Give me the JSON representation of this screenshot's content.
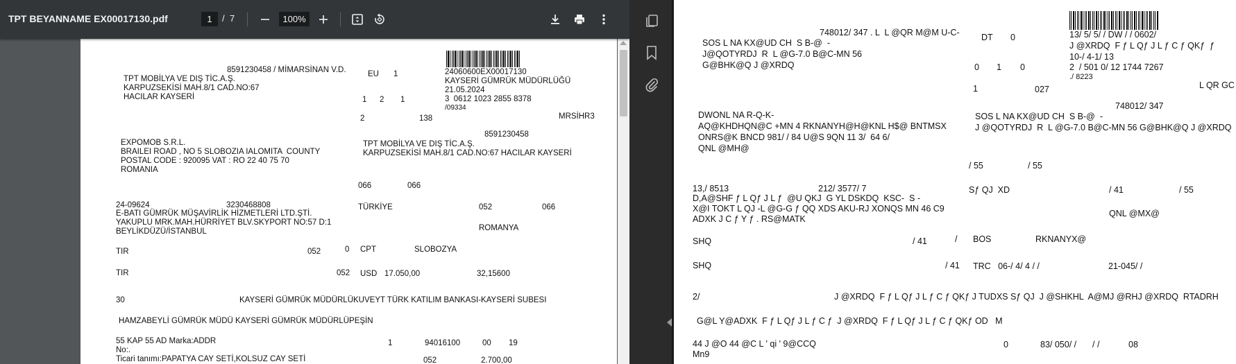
{
  "toolbar": {
    "title": "TPT BEYANNAME EX00017130.pdf",
    "page_current": "1",
    "page_sep": "/",
    "page_total": "7",
    "zoom": "100%",
    "icons": [
      "minus-icon",
      "plus-icon",
      "fit-page-icon",
      "rotate-icon",
      "download-icon",
      "print-icon",
      "more-vert-icon"
    ]
  },
  "sidebar": {
    "icons": [
      "copy-pages-icon",
      "bookmark-icon",
      "attachment-icon",
      "collapse-arrow-icon"
    ]
  },
  "doc": {
    "l1": "8591230458 / MİMARSİNAN V.D.",
    "l2": "TPT MOBİLYA VE DIŞ TİC.A.Ş.",
    "l3": "KARPUZSEKİSİ MAH.8/1 CAD.NO:67",
    "l4": "HACILAR KAYSERİ",
    "eu": "EU",
    "eu1": "1",
    "barnum": "24060600EX00017130",
    "gumruk": "KAYSERİ GÜMRÜK MÜDÜRLÜĞÜ",
    "date": "21.05.2024",
    "n1": "1",
    "n2": "2",
    "n3": "1",
    "ref": "3  0612 1023 2855 8378",
    "ref2": "/09334",
    "two": "2",
    "n138": "138",
    "mrsihr": "MRSİHR3",
    "expomob": "EXPOMOB S.R.L.",
    "brailei": "BRAILEI ROAD , NO 5 SLOBOZIA IALOMITA  COUNTY",
    "postal": "POSTAL CODE : 920095 VAT : RO 22 40 75 70",
    "romania": "ROMANIA",
    "tax2": "8591230458",
    "tpt2": "TPT MOBİLYA VE DIŞ TİC.A.Ş.",
    "karp2": "KARPUZSEKİSİ MAH.8/1 CAD.NO:67 HACILAR KAYSERİ",
    "c066a": "066",
    "c066b": "066",
    "code1": "24-09624",
    "code2": "3230468808",
    "ebati": "E-BATI GÜMRÜK MÜŞAVİRLİK HİZMETLERİ LTD.ŞTİ.",
    "yakuplu": "YAKUPLU MRK.MAH.HÜRRİYET BLV.SKYPORT NO:57 D:1",
    "beylik": "BEYLİKDÜZÜ/İSTANBUL",
    "turkiye": "TÜRKİYE",
    "c052a": "052",
    "c066c": "066",
    "romania2": "ROMANYA",
    "tir1": "TIR",
    "c052b": "052",
    "c0": "0",
    "cpt": "CPT",
    "slobozya": "SLOBOZYA",
    "tir2": "TIR",
    "c052c": "052",
    "usd": "USD",
    "amount": "17.050,00",
    "rate": "32,15600",
    "c30": "30",
    "kuveyt": "KAYSERİ GÜMRÜK MÜDÜRLÜKUVEYT TÜRK KATILIM BANKASI-KAYSERİ SUBESI",
    "hamza": "HAMZABEYLİ GÜMRÜK MÜDÜ KAYSERİ GÜMRÜK MÜDÜRLÜPEŞİN",
    "kap": "55 KAP 55 AD Marka:ADDR",
    "no": "No:.",
    "k1": "1",
    "hs": "94016100",
    "k00": "00",
    "k19": "19",
    "ticari": "Ticari tanımı:PAPATYA CAY SETİ,KOLSUZ CAY SETİ",
    "c052d": "052",
    "w2700": "2.700,00"
  },
  "raw": {
    "r1": "748012/ 347 . L  L @QR M@M U-C-",
    "r2": "SOS L NA KX@UD CH  S B-@  -",
    "r3": "J@QOTYRDJ  R  L @G-7.0 B@C-MN 56",
    "r4": "G@BHK@Q J @XRDQ",
    "dt": "DT",
    "dt0": "0",
    "rb1": "13/ 5/ 5/ / DW / / 0602/",
    "rb2": "J @XRDQ  F ƒ L Qƒ J L ƒ C ƒ QKƒ  ƒ",
    "rb3": "10-/ 4-1/ 13",
    "rb4": "2  / 501 0/ 12 1744 7267",
    "rb5": "./ 8223",
    "z0": "0",
    "z1": "1",
    "z2": "0",
    "one": "1",
    "c027": "027",
    "lqr": "L QR GC",
    "d1": "DWONL NA R-Q-K-",
    "d2": "AQ@KHDHQN@C +MN 4 RKNANYH@H@KNL H$@ BNTMSX",
    "d3": "ONRS@K BNCD 981/ / 84 U@S 9QN 11 3/  64 6/",
    "d4": "QNL @MH@",
    "e1": "748012/ 347",
    "e2": "SOS L NA KX@UD CH  S B-@  -",
    "e3": "J @QOTYRDJ  R  L @G-7.0 B@C-MN 56 G@BHK@Q J @XRDQ",
    "s55a": "/ 55",
    "s55b": "/ 55",
    "f1": "13,/ 8513",
    "f2": "212/ 3577/ 7",
    "f3": "D,A@SHF ƒ L Qƒ J L ƒ  @U QKJ  G YL DSKDQ  KSC-  S -",
    "f4": "X@I TOKT L QJ -L @G-G ƒ QQ XDS AKU-RJ XONQS MN 46 C9",
    "f5": "ADXK J C ƒ Y ƒ . RS@MATK",
    "sfqj": "Sƒ QJ  XD",
    "s41a": "/ 41",
    "s55c": "/ 55",
    "qnl": "QNL @MX@",
    "shq1": "SHQ",
    "s41b": "/ 41",
    "slash": "/",
    "bos": "BOS",
    "rkn": "RKNANYX@",
    "shq2": "SHQ",
    "s41c": "/ 41",
    "trc": "TRC   06-/ 4/ 4 / /",
    "num21": "21-045/ /",
    "two2": "2/",
    "long1": "J @XRDQ  F ƒ L Qƒ J L ƒ C ƒ QKƒ J TUDXS Sƒ QJ  J @SHKHL  A@MJ @RHJ @XRDQ  RTADRH",
    "long2": "G@L Y@ADXK  F ƒ L Qƒ J L ƒ C ƒ  J @XRDQ  F ƒ L Qƒ J L ƒ C ƒ QKƒ OD   M",
    "g1": "44 J @O 44 @C L ' qi ' 9@CCQ",
    "g2": "Mn9",
    "g0": "0",
    "g83": "83/ 050/ /",
    "gsl": "/ /",
    "g08": "08"
  }
}
